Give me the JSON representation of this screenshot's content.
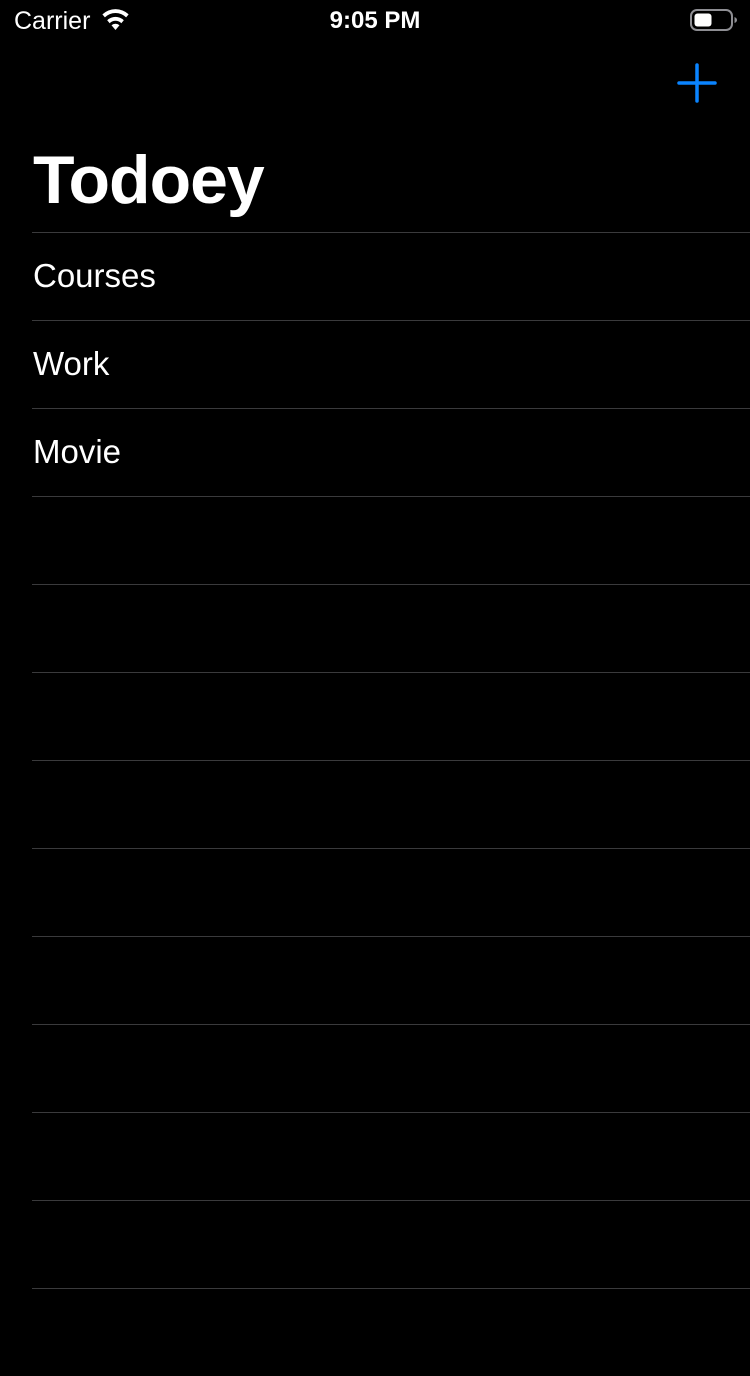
{
  "status_bar": {
    "carrier": "Carrier",
    "time": "9:05 PM",
    "wifi_icon": "wifi-icon",
    "battery_icon": "battery-icon"
  },
  "nav": {
    "title": "Todoey",
    "add_icon": "plus-icon",
    "accent_color": "#0a84ff"
  },
  "categories": [
    {
      "label": "Courses"
    },
    {
      "label": "Work"
    },
    {
      "label": "Movie"
    },
    {
      "label": ""
    },
    {
      "label": ""
    },
    {
      "label": ""
    },
    {
      "label": ""
    },
    {
      "label": ""
    },
    {
      "label": ""
    },
    {
      "label": ""
    },
    {
      "label": ""
    },
    {
      "label": ""
    },
    {
      "label": ""
    }
  ],
  "colors": {
    "background": "#000000",
    "separator": "#3a3a3c",
    "text": "#ffffff"
  }
}
